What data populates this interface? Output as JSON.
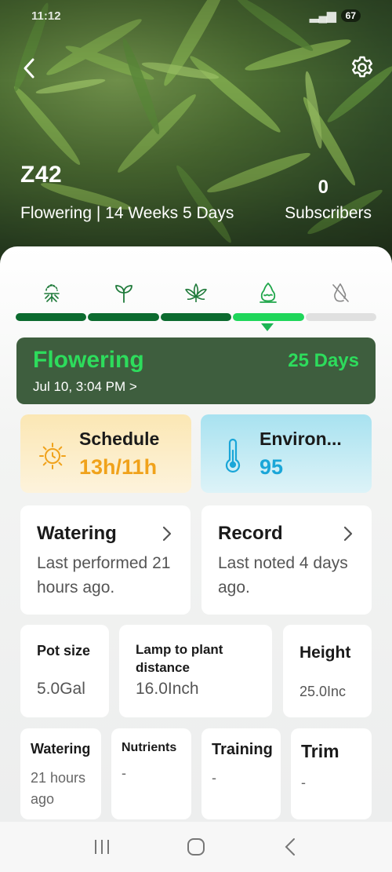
{
  "status_bar": {
    "time": "11:12",
    "battery": "67"
  },
  "header": {
    "plant_name": "Z42",
    "stage_line": "Flowering | 14 Weeks 5 Days",
    "subscribers_count": "0",
    "subscribers_label": "Subscribers"
  },
  "stages": [
    {
      "icon": "germination-icon",
      "active": false
    },
    {
      "icon": "seedling-icon",
      "active": false
    },
    {
      "icon": "vegetative-leaf-icon",
      "active": false
    },
    {
      "icon": "flowering-icon",
      "active": true
    },
    {
      "icon": "harvest-disabled-icon",
      "active": false
    }
  ],
  "colors": {
    "progress_done": "#0c6b2f",
    "progress_current": "#1fd65a",
    "progress_todo": "#e0e0e0",
    "accent_green": "#2ddc5c",
    "card_dark": "#3e5e3e",
    "schedule_orange": "#f0a21b",
    "environ_blue": "#1aa6d8"
  },
  "phase_card": {
    "title": "Flowering",
    "days": "25 Days",
    "date": "Jul 10, 3:04 PM >"
  },
  "schedule": {
    "title": "Schedule",
    "value": "13h/11h"
  },
  "environment": {
    "title": "Environ...",
    "value": "95"
  },
  "watering_card": {
    "title": "Watering",
    "subtitle": "Last performed 21 hours ago."
  },
  "record_card": {
    "title": "Record",
    "subtitle": "Last noted 4 days ago."
  },
  "pot_size": {
    "label": "Pot size",
    "value": "5.0Gal"
  },
  "lamp_distance": {
    "label": "Lamp to plant distance",
    "value": "16.0Inch"
  },
  "height": {
    "label": "Height",
    "value": "25.0Inc"
  },
  "watering_small": {
    "label": "Watering",
    "value": "21 hours ago"
  },
  "nutrients": {
    "label": "Nutrients",
    "value": "-"
  },
  "training": {
    "label": "Training",
    "value": "-"
  },
  "trim": {
    "label": "Trim",
    "value": "-"
  }
}
